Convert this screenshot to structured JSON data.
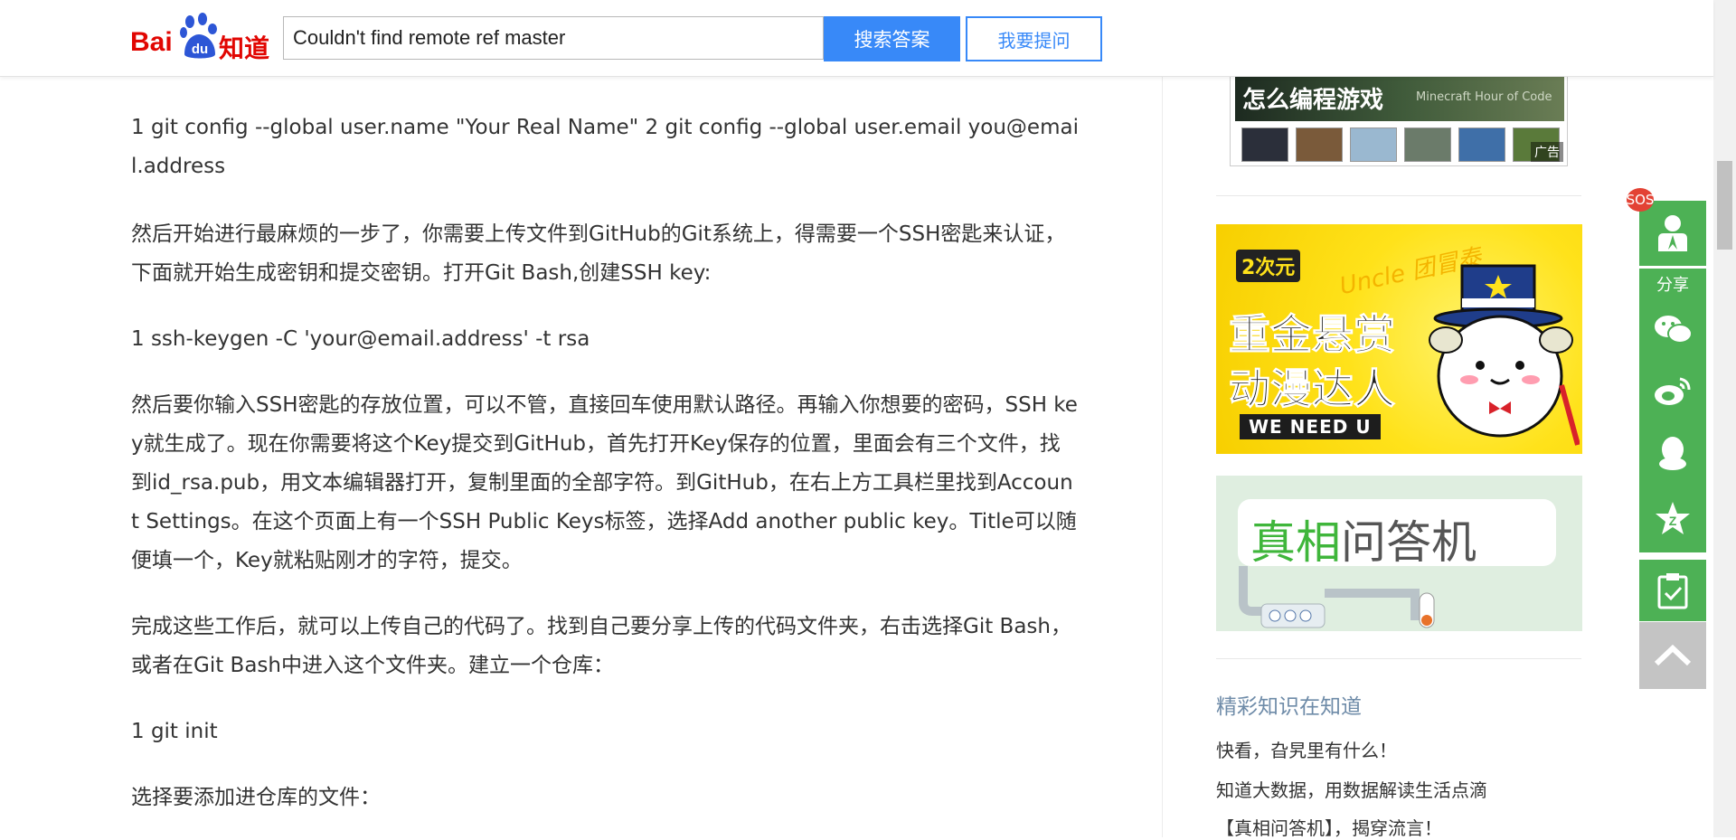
{
  "header": {
    "logo_text_left": "Bai",
    "logo_text_paw": "du",
    "logo_text_right": "知道",
    "search_value": "Couldn't find remote ref master",
    "search_button": "搜索答案",
    "ask_button": "我要提问"
  },
  "article": {
    "paragraphs": [
      "1 git config --global user.name \"Your Real Name\" 2 git config --global user.email you@email.address",
      "然后开始进行最麻烦的一步了，你需要上传文件到GitHub的Git系统上，得需要一个SSH密匙来认证，下面就开始生成密钥和提交密钥。打开Git Bash,创建SSH key:",
      "1 ssh-keygen -C 'your@email.address' -t rsa",
      "然后要你输入SSH密匙的存放位置，可以不管，直接回车使用默认路径。再输入你想要的密码，SSH key就生成了。现在你需要将这个Key提交到GitHub，首先打开Key保存的位置，里面会有三个文件，找到id_rsa.pub，用文本编辑器打开，复制里面的全部字符。到GitHub，在右上方工具栏里找到Account Settings。在这个页面上有一个SSH Public Keys标签，选择Add another public key。Title可以随便填一个，Key就粘贴刚才的字符，提交。",
      "完成这些工作后，就可以上传自己的代码了。找到自己要分享上传的代码文件夹，右击选择Git Bash，或者在Git Bash中进入这个文件夹。建立一个仓库：",
      "1 git init",
      "选择要添加进仓库的文件："
    ]
  },
  "sidebar": {
    "ad_top_title": "怎么编程游戏",
    "ad_top_sub": "Minecraft Hour of Code",
    "ad_tag": "广告",
    "ad_yellow": {
      "brand": "2次元",
      "uncle": "Uncle 团冒泰",
      "headline_1": "重金悬赏",
      "headline_2": "动漫达人",
      "tagline": "WE NEED U"
    },
    "ad_green": {
      "highlight": "真相",
      "rest": "问答机"
    },
    "hot_title": "精彩知识在知道",
    "hot_items": [
      "快看，旮旯里有什么！",
      "知道大数据，用数据解读生活点滴",
      "【真相问答机】，揭穿流言！"
    ]
  },
  "toolbar": {
    "sos_label": "SOS",
    "share_label": "分享",
    "items": [
      "user-icon",
      "wechat-icon",
      "weibo-icon",
      "qq-icon",
      "qzone-icon",
      "clipboard-icon",
      "back-to-top-icon"
    ]
  },
  "colors": {
    "accent": "#3889f8",
    "toolbar_green": "#4db155",
    "baidu_red": "#e10602"
  }
}
